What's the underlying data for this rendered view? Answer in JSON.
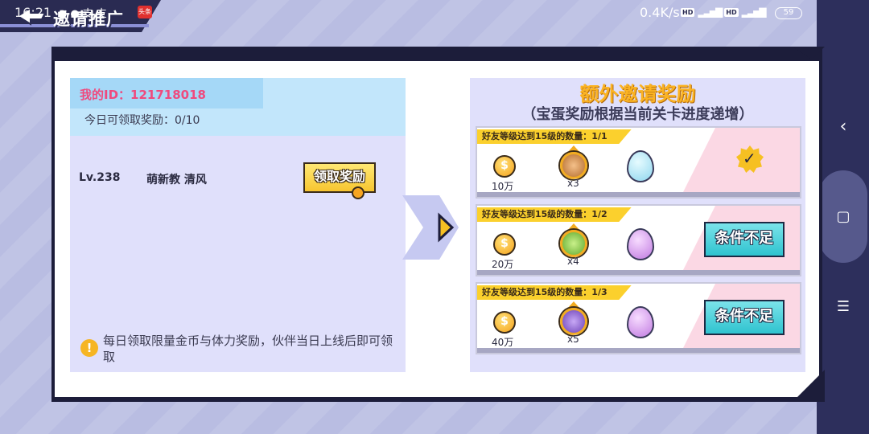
{
  "status_bar": {
    "time": "16:21",
    "network_speed": "0.4K/s",
    "hd1": "HD",
    "hd2": "HD",
    "battery": "59",
    "notif_text": "●●支支",
    "app_badge": "头条"
  },
  "header": {
    "title": "邀请推广"
  },
  "left_panel": {
    "my_id_label": "我的ID：121718018",
    "daily_claim": "今日可领取奖励：0/10",
    "friend": {
      "level": "Lv.238",
      "name": "萌新教 清风"
    },
    "claim_button": "领取奖励",
    "info_text": "每日领取限量金币与体力奖励，伙伴当日上线后即可领取"
  },
  "right_panel": {
    "title": "额外邀请奖励",
    "subtitle": "（宝蛋奖励根据当前关卡进度递增）",
    "rows": [
      {
        "label": "好友等级达到15级的数量：1/1",
        "coin_amount": "10万",
        "multiplier": "x3",
        "egg_color": "blue",
        "status": "completed"
      },
      {
        "label": "好友等级达到15级的数量：1/2",
        "coin_amount": "20万",
        "multiplier": "x4",
        "egg_color": "purple",
        "status": "条件不足"
      },
      {
        "label": "好友等级达到15级的数量：1/3",
        "coin_amount": "40万",
        "multiplier": "x5",
        "egg_color": "purple",
        "status": "条件不足"
      }
    ]
  },
  "nav": {
    "back": "‹",
    "home": "▢",
    "menu": "☰"
  },
  "colors": {
    "background": "#b9bde2",
    "frame": "#1c1d3a",
    "card": "#e0e0fb",
    "accent_pink": "#ef4a7e",
    "title_orange": "#fbb322",
    "cond_button": "#2fc3cf"
  }
}
